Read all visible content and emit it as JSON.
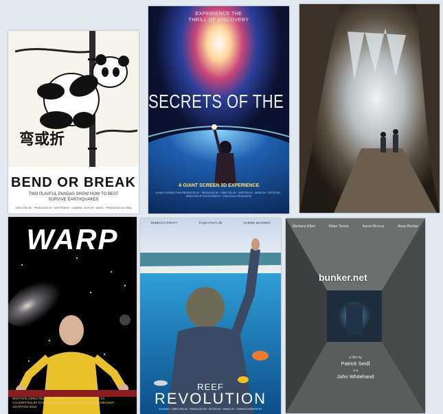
{
  "posters": [
    {
      "title": "BEND OR BREAK",
      "calligraphy": "弯或折",
      "tagline": "TWO PLAYFUL PANDAS SHOW HOW TO BEST SURVIVE EARTHQUAKES",
      "credits": "DIRECTED BY · PRODUCED BY · WRITTEN BY · CAMERA · EDITOR · MUSIC · PRODUCED IN CHINA"
    },
    {
      "tag_line1": "EXPERIENCE THE",
      "tag_line2": "THRILL OF DISCOVERY",
      "title": "SECRETS OF THE UNIVERSE",
      "tagline": "A GIANT SCREEN 3D EXPERIENCE",
      "credits": "A GIANT SCREEN FILM PRESENTED BY · PRODUCED BY · DIRECTED BY · WRITTEN BY · MUSIC BY · EDITED BY · DIRECTOR OF PHOTOGRAPHY · EXECUTIVE PRODUCERS"
    },
    {
      "title": ""
    },
    {
      "title": "WARP",
      "credits_line1": "WRITTEN, DIRECTED AND CINEMATOGRAPHY BY GEN SETO",
      "credits_line2": "CO-WRITTEN BY KONEL ODERHOLZER & ANDREAS ROSENBAUER",
      "credits_line3": "ADAPTION 2019"
    },
    {
      "name1": "REBECCA PIRATT",
      "name2": "Project Reef Life",
      "name3": "SABINE MCEWEN",
      "title_line1": "REEF",
      "title_line2": "REVOLUTION",
      "credits": "A FILM BY · DIRECTED BY · PRODUCED BY · EDITED BY · MUSIC BY · CINEMATOGRAPHY BY"
    },
    {
      "name1": "Marleine Elbel",
      "name2": "Kilian Tennis",
      "name3": "Aaron Brocca",
      "name4": "Anna Richter",
      "title": "bunker.net",
      "film_by": "a film by",
      "director1": "Patrick Seidl",
      "and": "and",
      "director2": "John Whitehand"
    }
  ],
  "colors": {
    "background": "#e3e9f1",
    "universe_yellow": "#ffe36a",
    "warp_credits": "#f0d36b"
  }
}
